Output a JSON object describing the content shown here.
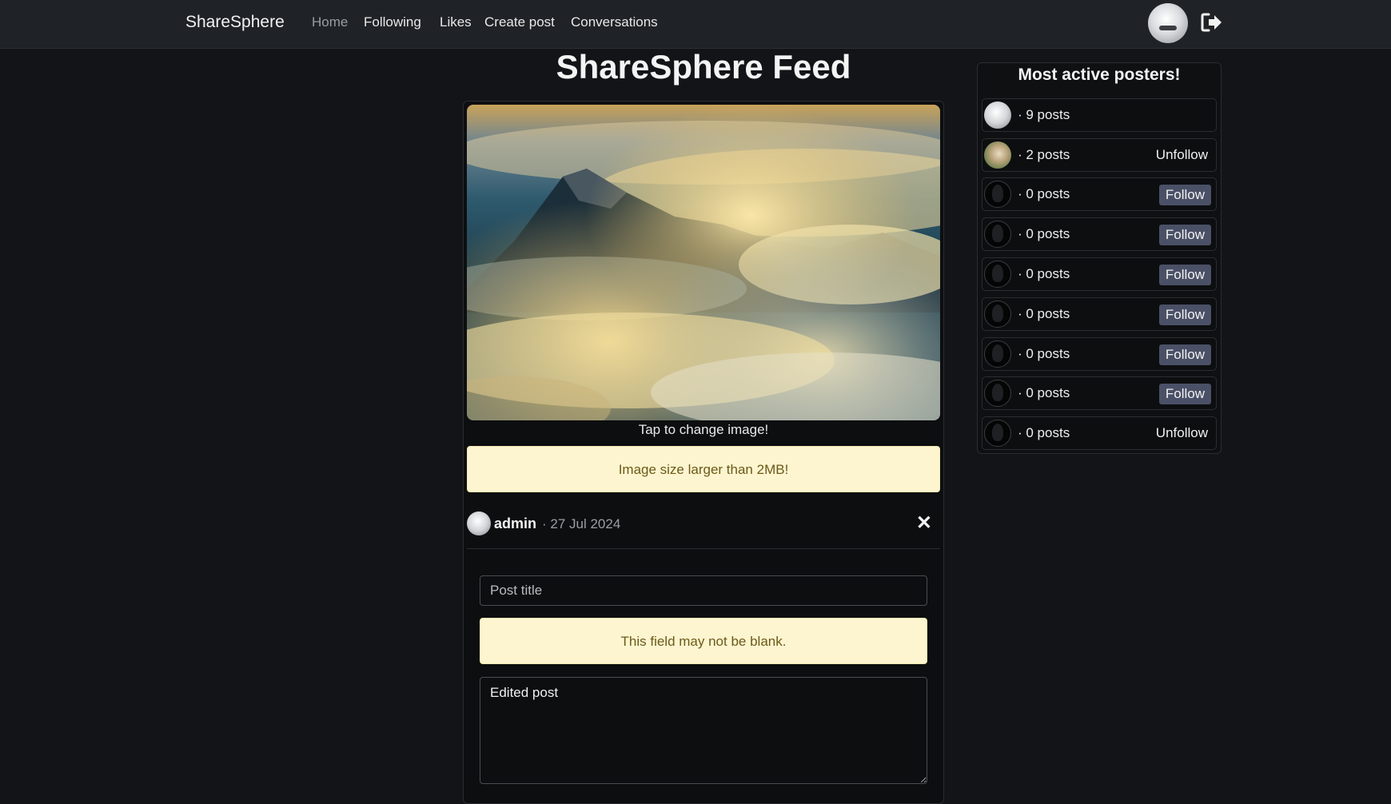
{
  "navbar": {
    "brand": "ShareSphere",
    "links": [
      {
        "label": "Home",
        "active": true
      },
      {
        "label": "Following"
      },
      {
        "label": "Likes"
      },
      {
        "label": "Create post"
      },
      {
        "label": "Conversations"
      }
    ],
    "icons": {
      "avatar": "user-avatar",
      "logout": "sign-out-icon"
    }
  },
  "feed": {
    "title": "ShareSphere Feed",
    "image_hint": "Tap to change image!",
    "image_error": "Image size larger than 2MB!",
    "author": "admin",
    "date": "· 27 Jul 2024",
    "close_symbol": "✕",
    "title_placeholder": "Post title",
    "title_value": "",
    "title_error": "This field may not be blank.",
    "content_value": "Edited post"
  },
  "sidebar": {
    "title": "Most active posters!",
    "posters": [
      {
        "count": "· 9 posts",
        "action": ""
      },
      {
        "count": "· 2 posts",
        "action": "Unfollow"
      },
      {
        "count": "· 0 posts",
        "action": "Follow"
      },
      {
        "count": "· 0 posts",
        "action": "Follow"
      },
      {
        "count": "· 0 posts",
        "action": "Follow"
      },
      {
        "count": "· 0 posts",
        "action": "Follow"
      },
      {
        "count": "· 0 posts",
        "action": "Follow"
      },
      {
        "count": "· 0 posts",
        "action": "Follow"
      },
      {
        "count": "· 0 posts",
        "action": "Unfollow"
      }
    ]
  },
  "colors": {
    "background": "#121417",
    "navbar": "#1f2226",
    "alert_bg": "#fdf5d0",
    "alert_text": "#6b5a18",
    "follow_btn": "#4a5066"
  }
}
